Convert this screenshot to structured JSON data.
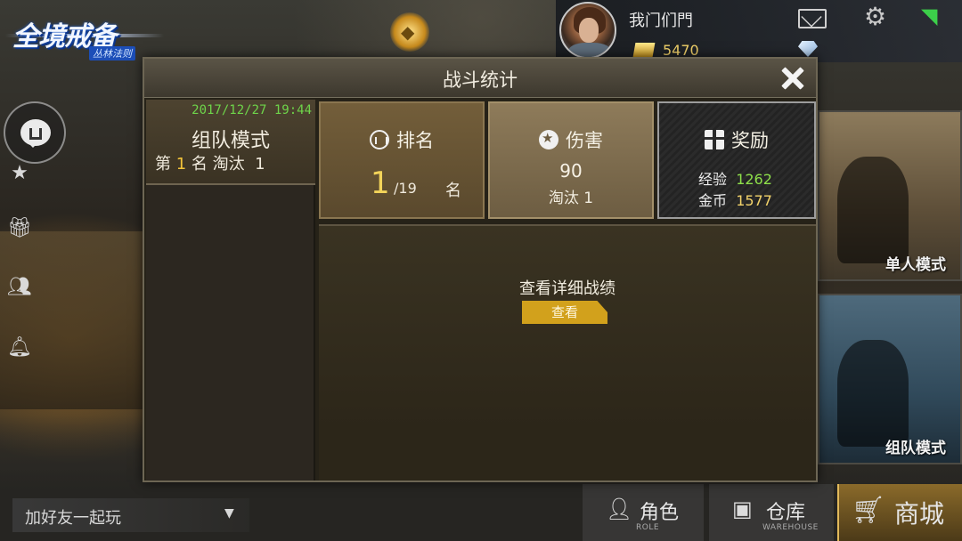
{
  "game": {
    "logo_main": "全境戒备",
    "logo_sub": "丛林法则"
  },
  "player": {
    "name": "我门们門",
    "gold": "5470"
  },
  "colors": {
    "accent_gold": "#d2a11c",
    "highlight_green": "#6ed44a",
    "wifi_green": "#3ccf4a"
  },
  "icons": {
    "mail": "mail-icon",
    "settings": "gear-icon",
    "wifi": "wifi-icon",
    "chat": "chat-bubble-icon",
    "star": "star-icon",
    "gift": "gift-icon",
    "friends": "friends-icon",
    "bell": "bell-icon"
  },
  "modal": {
    "title": "战斗统计",
    "match": {
      "date": "2017/12/27 19:44",
      "mode": "组队模式",
      "rank_prefix": "第",
      "rank": "1",
      "rank_suffix": "名 淘汰",
      "kills": "1"
    },
    "stats": {
      "rank_label": "排名",
      "rank_value": "1",
      "rank_total": "/19",
      "rank_unit": "名",
      "damage_label": "伤害",
      "damage_value": "90",
      "kill_label": "淘汰",
      "kill_value": "1",
      "reward_label": "奖励",
      "exp_label": "经验",
      "exp_value": "1262",
      "gold_label": "金币",
      "gold_value": "1577"
    },
    "detail_text": "查看详细战绩",
    "view_button": "查看"
  },
  "modes": {
    "solo": "单人模式",
    "squad": "组队模式"
  },
  "bottom": {
    "invite": "加好友一起玩",
    "role_label": "角色",
    "role_sub": "ROLE",
    "warehouse_label": "仓库",
    "warehouse_sub": "WAREHOUSE",
    "shop_label": "商城"
  }
}
